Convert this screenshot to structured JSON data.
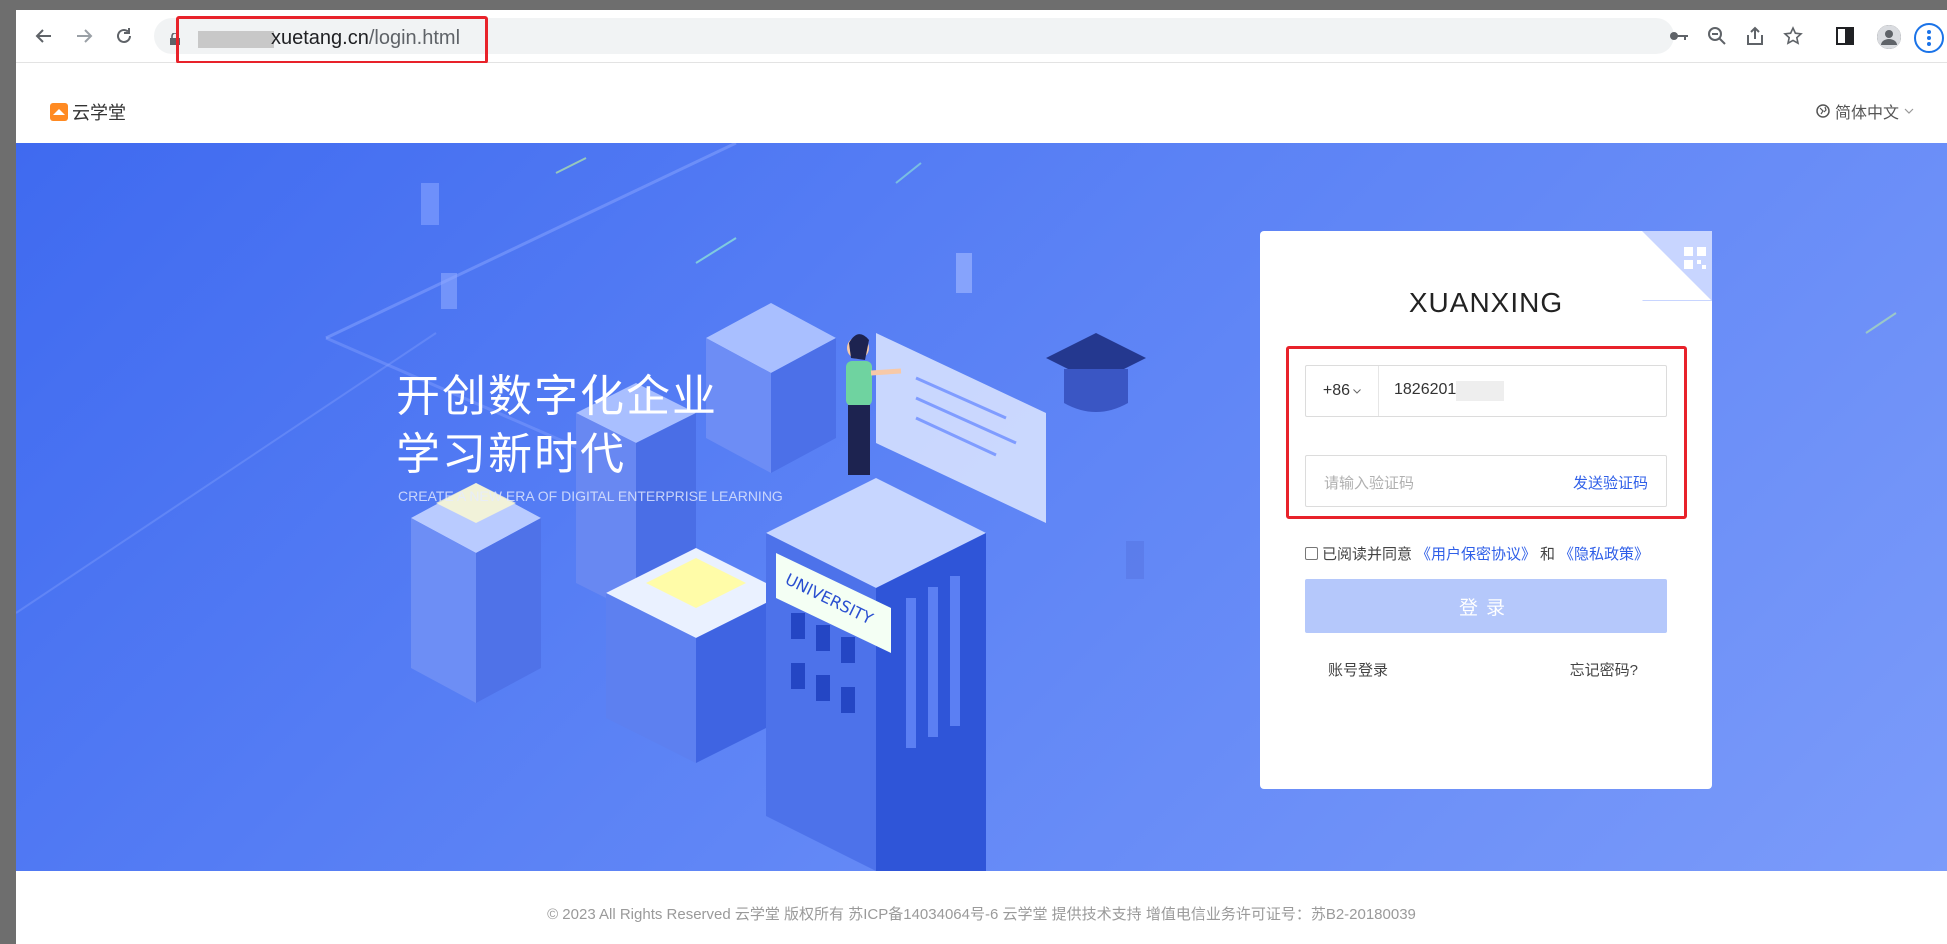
{
  "browser": {
    "url_domain_visible": "xuetang.cn",
    "url_path": "/login.html",
    "icons": {
      "back": "arrow-left-icon",
      "forward": "arrow-right-icon",
      "reload": "reload-icon",
      "lock": "lock-icon",
      "key": "key-icon",
      "zoom": "zoom-out-icon",
      "share": "share-icon",
      "bookmark": "star-icon",
      "sidepanel": "side-panel-icon",
      "profile": "profile-icon",
      "menu": "more-vertical-icon"
    }
  },
  "header": {
    "logo_text": "云学堂",
    "language": "简体中文"
  },
  "hero": {
    "title_line1": "开创数字化企业",
    "title_line2": "学习新时代",
    "subtitle": "CREATE A NEW ERA OF DIGITAL ENTERPRISE LEARNING",
    "sign_text": "UNIVERSITY"
  },
  "login": {
    "title": "XUANXING",
    "country_code": "+86",
    "phone_value": "1826201",
    "code_placeholder": "请输入验证码",
    "send_code": "发送验证码",
    "agree_prefix": "已阅读并同意",
    "agree_link1": "《用户保密协议》",
    "agree_and": "和",
    "agree_link2": "《隐私政策》",
    "login_button": "登录",
    "account_login": "账号登录",
    "forgot_password": "忘记密码?"
  },
  "footer": {
    "text": "© 2023 All Rights Reserved 云学堂 版权所有 苏ICP备14034064号-6    云学堂 提供技术支持 增值电信业务许可证号：苏B2-20180039"
  },
  "colors": {
    "accent": "#2f5fe8",
    "hero_start": "#3f6af0",
    "hero_end": "#7b9bfa",
    "button_disabled": "#b5c8fb",
    "highlight": "#e8222a"
  }
}
